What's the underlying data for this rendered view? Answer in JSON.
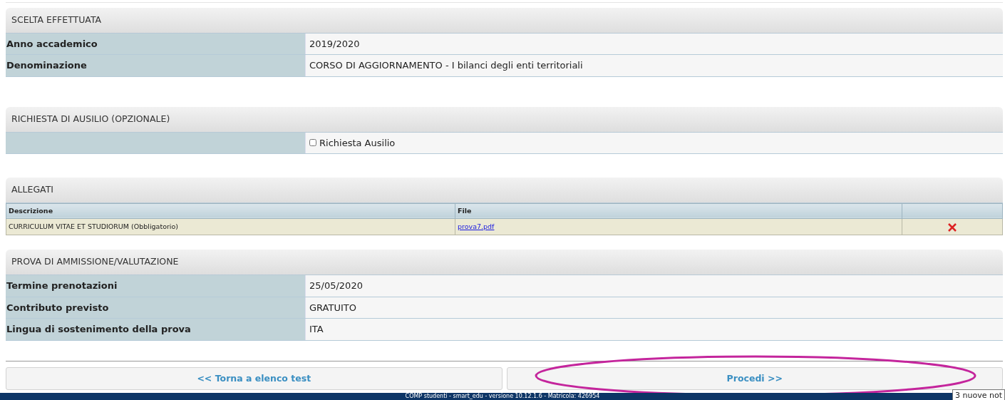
{
  "sections": [
    {
      "kind": "fields",
      "title": "SCELTA EFFETTUATA",
      "rows": [
        {
          "label": "Anno accademico",
          "value": "2019/2020"
        },
        {
          "label": "Denominazione",
          "value": "CORSO DI AGGIORNAMENTO - I bilanci degli enti territoriali"
        }
      ]
    },
    {
      "kind": "checkbox",
      "title": "RICHIESTA DI AUSILIO (OPZIONALE)",
      "option": {
        "label": "Richiesta Ausilio",
        "checked": false
      }
    },
    {
      "kind": "attachments",
      "title": "ALLEGATI",
      "columns": [
        "Descrizione",
        "File"
      ],
      "rows": [
        {
          "description": "CURRICULUM VITAE ET STUDIORUM (Obbligatorio)",
          "file": "prova7.pdf"
        }
      ]
    },
    {
      "kind": "fields",
      "title": "PROVA DI AMMISSIONE/VALUTAZIONE",
      "rows": [
        {
          "label": "Termine prenotazioni",
          "value": "25/05/2020"
        },
        {
          "label": "Contributo previsto",
          "value": "GRATUITO"
        },
        {
          "label": "Lingua di sostenimento della prova",
          "value": "ITA"
        }
      ]
    }
  ],
  "buttons": [
    {
      "label": "<< Torna a elenco test",
      "highlighted": false
    },
    {
      "label": "Procedi >>",
      "highlighted": true
    }
  ],
  "footer": "COMP studenti - smart_edu - versione 10.12.1.6 - Matricola: 426954",
  "tooltip": "3 nuove not"
}
